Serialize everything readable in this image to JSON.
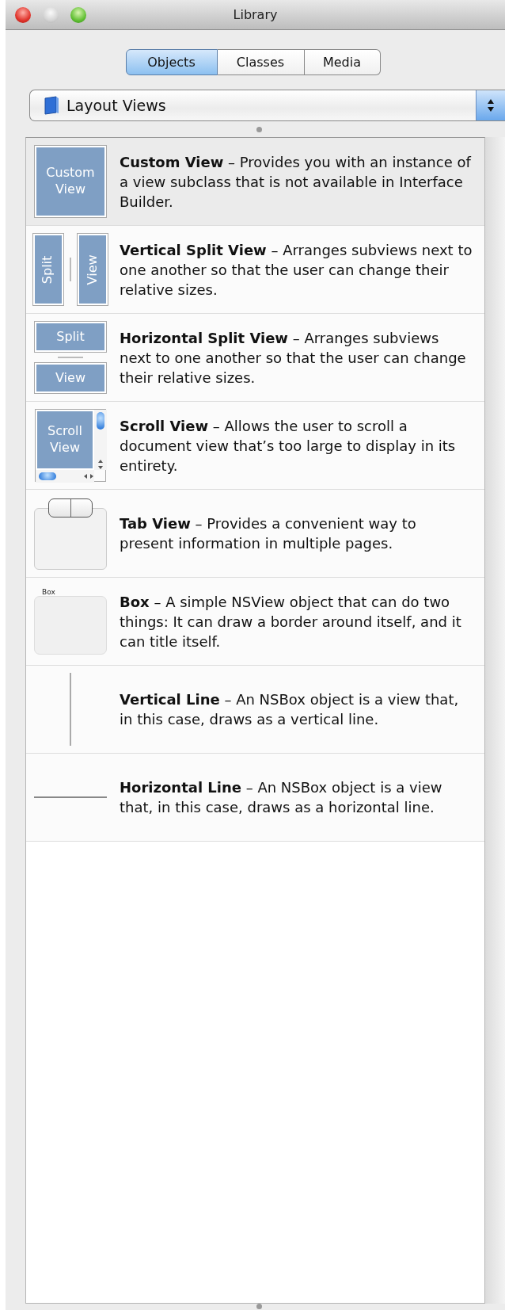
{
  "window": {
    "title": "Library"
  },
  "tabs": [
    {
      "label": "Objects",
      "selected": true
    },
    {
      "label": "Classes",
      "selected": false
    },
    {
      "label": "Media",
      "selected": false
    }
  ],
  "popup": {
    "value": "Layout Views"
  },
  "items": [
    {
      "kind": "custom",
      "thumb_labels": [
        "Custom View"
      ],
      "text": "**Custom View** – Provides you with an instance of a view subclass that is not available in Interface Builder.",
      "selected": true
    },
    {
      "kind": "vsplit",
      "thumb_labels": [
        "Split",
        "View"
      ],
      "text": "**Vertical Split View** – Arranges subviews next to one another so that the user can change their relative sizes.",
      "selected": false
    },
    {
      "kind": "hsplit",
      "thumb_labels": [
        "Split",
        "View"
      ],
      "text": "**Horizontal Split View** – Arranges subviews next to one another so that the user can change their relative sizes.",
      "selected": false
    },
    {
      "kind": "scroll",
      "thumb_labels": [
        "Scroll View"
      ],
      "text": "**Scroll View** – Allows the user to scroll a document view that’s too large to display in its entirety.",
      "selected": false
    },
    {
      "kind": "tab",
      "text": "**Tab View** – Provides a convenient way to present information in multiple pages.",
      "selected": false
    },
    {
      "kind": "box",
      "thumb_labels": [
        "Box"
      ],
      "text": "**Box** – A simple NSView object that can do two things: It can draw a border around itself, and it can title itself.",
      "selected": false
    },
    {
      "kind": "vline",
      "text": "**Vertical Line** – An NSBox object is a view that, in this case, draws as a vertical line.",
      "selected": false
    },
    {
      "kind": "hline",
      "text": "**Horizontal Line** – An NSBox object is a view that, in this case, draws as a horizontal line.",
      "selected": false
    }
  ]
}
